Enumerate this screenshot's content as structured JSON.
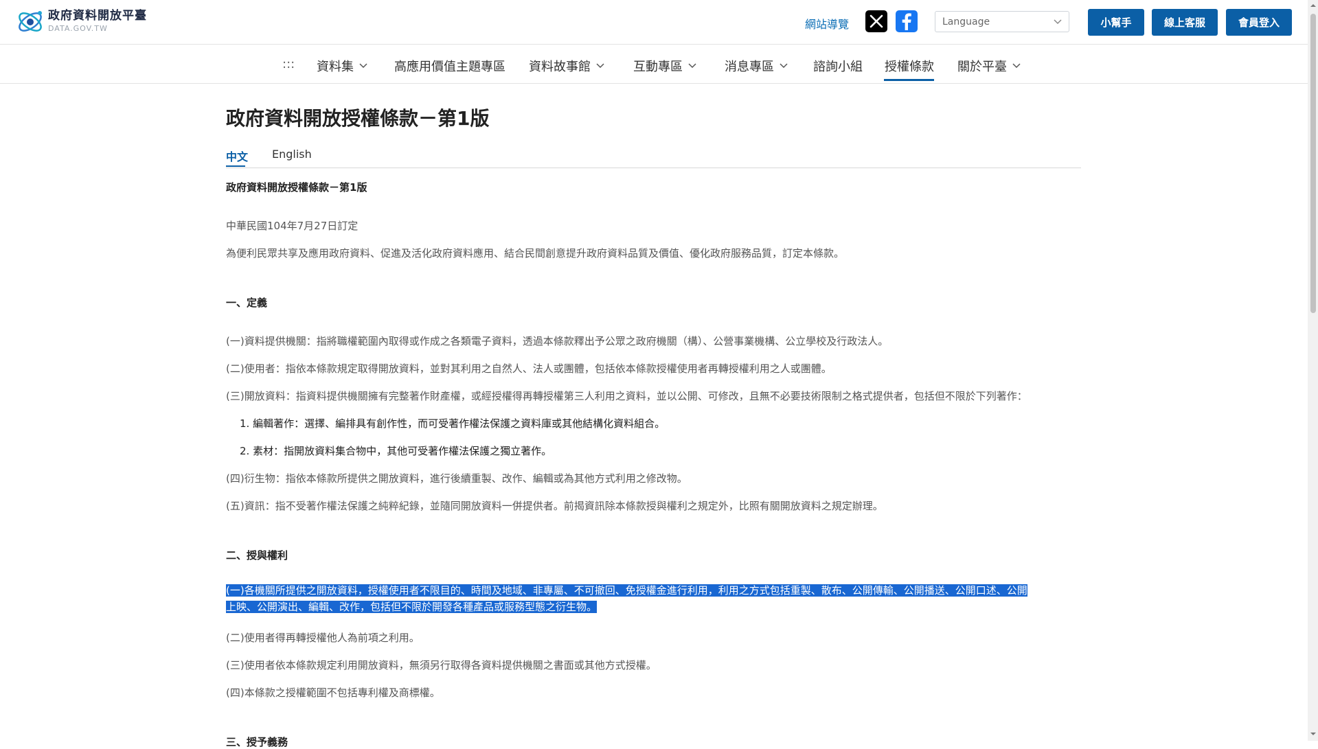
{
  "header": {
    "logo_cn": "政府資料開放平臺",
    "logo_en": "DATA.GOV.TW",
    "sitemap": "網站導覽",
    "language_placeholder": "Language",
    "buttons": {
      "helper": "小幫手",
      "service": "線上客服",
      "login": "會員登入"
    }
  },
  "nav": {
    "menu": ":::",
    "items": [
      {
        "label": "資料集"
      },
      {
        "label": "高應用價值主題專區"
      },
      {
        "label": "資料故事館"
      },
      {
        "label": "互動專區"
      },
      {
        "label": "消息專區"
      },
      {
        "label": "諮詢小組"
      },
      {
        "label": "授權條款"
      },
      {
        "label": "關於平臺"
      }
    ]
  },
  "page": {
    "title": "政府資料開放授權條款－第1版",
    "tabs": [
      "中文",
      "English"
    ],
    "subtitle": "政府資料開放授權條款－第1版",
    "date": "中華民國104年7月27日訂定",
    "intro": "為便利民眾共享及應用政府資料、促進及活化政府資料應用、結合民間創意提升政府資料品質及價值、優化政府服務品質，訂定本條款。",
    "section1": {
      "heading": "一、定義",
      "items": [
        "(一)資料提供機關：指將職權範圍內取得或作成之各類電子資料，透過本條款釋出予公眾之政府機關（構）、公營事業機構、公立學校及行政法人。",
        "(二)使用者：指依本條款規定取得開放資料，並對其利用之自然人、法人或團體，包括依本條款授權使用者再轉授權利用之人或團體。",
        "(三)開放資料：指資料提供機關擁有完整著作財產權，或經授權得再轉授權第三人利用之資料，並以公開、可修改，且無不必要技術限制之格式提供者，包括但不限於下列著作：",
        "1. 編輯著作：選擇、編排具有創作性，而可受著作權法保護之資料庫或其他結構化資料組合。",
        "2. 素材：指開放資料集合物中，其他可受著作權法保護之獨立著作。",
        "(四)衍生物：指依本條款所提供之開放資料，進行後續重製、改作、編輯或為其他方式利用之修改物。",
        "(五)資訊：指不受著作權法保護之純粹紀錄，並隨同開放資料一併提供者。前揭資訊除本條款授與權利之規定外，比照有關開放資料之規定辦理。"
      ]
    },
    "section2": {
      "heading": "二、授與權利",
      "highlight_line1": "(一)各機關所提供之開放資料，授權使用者不限目的、時間及地域、非專屬、不可撤回、免授權金進行利用，利用之方式包括重製、散布、公開傳輸、公開播送、公開口述、公開",
      "highlight_line2": "上映、公開演出、編輯、改作，包括但不限於開發各種產品或服務型態之衍生物。",
      "items": [
        "(二)使用者得再轉授權他人為前項之利用。",
        "(三)使用者依本條款規定利用開放資料，無須另行取得各資料提供機關之書面或其他方式授權。",
        "(四)本條款之授權範圍不包括專利權及商標權。"
      ]
    },
    "section3": {
      "heading": "三、授予義務"
    }
  },
  "colors": {
    "primary": "#0b5fa6",
    "link": "#0a6db5",
    "selection": "#1967d2"
  },
  "icons": {
    "x": "x-logo-icon",
    "facebook": "facebook-icon",
    "chevron": "chevron-down-icon"
  }
}
